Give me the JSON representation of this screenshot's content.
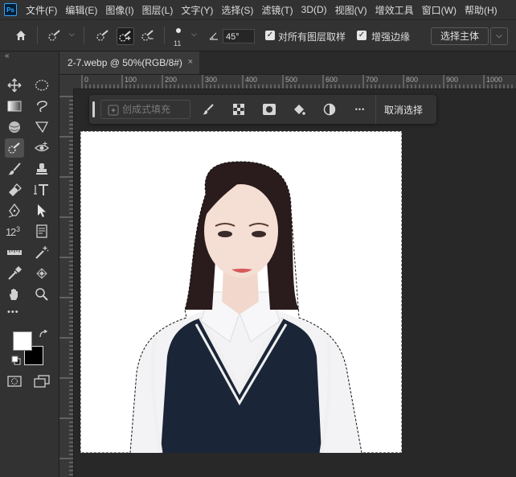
{
  "app": {
    "logo_text": "Ps"
  },
  "menu": [
    "文件(F)",
    "编辑(E)",
    "图像(I)",
    "图层(L)",
    "文字(Y)",
    "选择(S)",
    "滤镜(T)",
    "3D(D)",
    "视图(V)",
    "增效工具",
    "窗口(W)",
    "帮助(H)"
  ],
  "options": {
    "brush_size": "11",
    "angle_value": "45°",
    "sample_all_layers_label": "对所有图层取样",
    "sample_all_layers_checked": true,
    "enhance_edge_label": "增强边缘",
    "enhance_edge_checked": true,
    "select_subject_label": "选择主体"
  },
  "document_tab": {
    "title": "2-7.webp @ 50%(RGB/8#)",
    "close": "×"
  },
  "ruler": {
    "ticks": [
      "0",
      "100",
      "200",
      "300",
      "400",
      "500",
      "600",
      "700",
      "800",
      "900",
      "1000"
    ]
  },
  "context_bar": {
    "generative_fill_label": "创成式填充",
    "deselect_label": "取消选择",
    "more_label": "•••"
  },
  "toolbar": {
    "more_label": "•••",
    "collapse_label": "«"
  },
  "colors": {
    "foreground": "#ffffff",
    "background": "#000000",
    "accent": "#31a8ff",
    "panel": "#323232",
    "canvas_bg": "#282828",
    "vest": "#1b2538",
    "shirt": "#f4f4f6",
    "hair": "#2a1c1c"
  }
}
